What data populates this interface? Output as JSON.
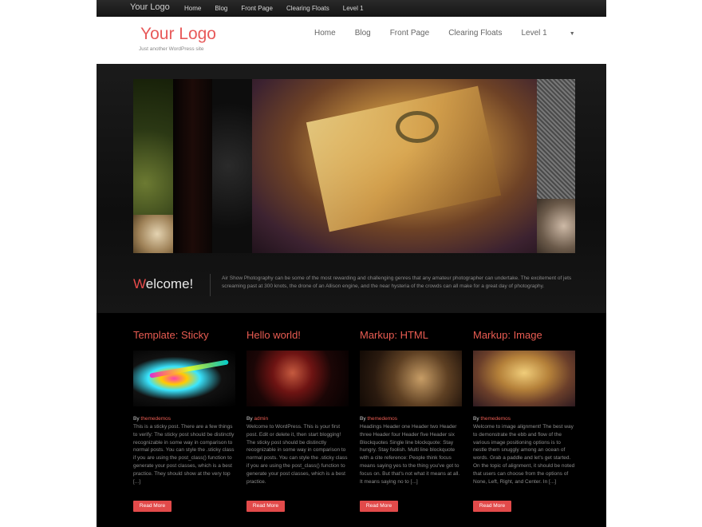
{
  "topbar": {
    "logo": "Your Logo",
    "nav": [
      "Home",
      "Blog",
      "Front Page",
      "Clearing Floats",
      "Level 1"
    ]
  },
  "header": {
    "logo": "Your Logo",
    "tagline": "Just another WordPress site",
    "nav": [
      "Home",
      "Blog",
      "Front Page",
      "Clearing Floats",
      "Level 1"
    ],
    "dropdown_icon": "chevron-down-icon"
  },
  "hero": {
    "welcome_first_letter": "W",
    "welcome_rest": "elcome!",
    "text": "Air Show Photography can be some of the most rewarding and challenging genres that any amateur photographer can undertake. The excitement of jets screaming past at 300 knots, the drone of an Allison engine, and the near hysteria of the crowds can all make for a great day of photography."
  },
  "posts": [
    {
      "title": "Template: Sticky",
      "by": "By",
      "author": "themedemos",
      "excerpt": "This is a sticky post. There are a few things to verify: The sticky post should be distinctly recognizable in some way in comparison to normal posts. You can style the .sticky class if you are using the post_class() function to generate your post classes, which is a best practice. They should show at the very top [...]",
      "button": "Read More"
    },
    {
      "title": "Hello world!",
      "by": "By",
      "author": "admin",
      "excerpt": "Welcome to WordPress. This is your first post. Edit or delete it, then start blogging! The sticky post should be distinctly recognizable in some way in comparison to normal posts. You can style the .sticky class if you are using the post_class() function to generate your post classes, which is a best practice.",
      "button": "Read More"
    },
    {
      "title": "Markup: HTML",
      "by": "By",
      "author": "themedemos",
      "excerpt": "Headings Header one Header two Header three Header four Header five Header six Blockquotes Single line blockquote: Stay hungry. Stay foolish. Multi line blockquote with a cite reference: People think focus means saying yes to the thing you've got to focus on. But that's not what it means at all. It means saying no to [...]",
      "button": "Read More"
    },
    {
      "title": "Markup: Image",
      "by": "By",
      "author": "themedemos",
      "excerpt": "Welcome to image alignment! The best way to demonstrate the ebb and flow of the various image positioning options is to nestle them snuggly among an ocean of words. Grab a paddle and let's get started. On the topic of alignment, it should be noted that users can choose from the options of None, Left, Right, and Center. In [...]",
      "button": "Read More"
    }
  ],
  "colors": {
    "accent": "#e95c52",
    "button": "#e24a4a",
    "dark": "#000000"
  }
}
